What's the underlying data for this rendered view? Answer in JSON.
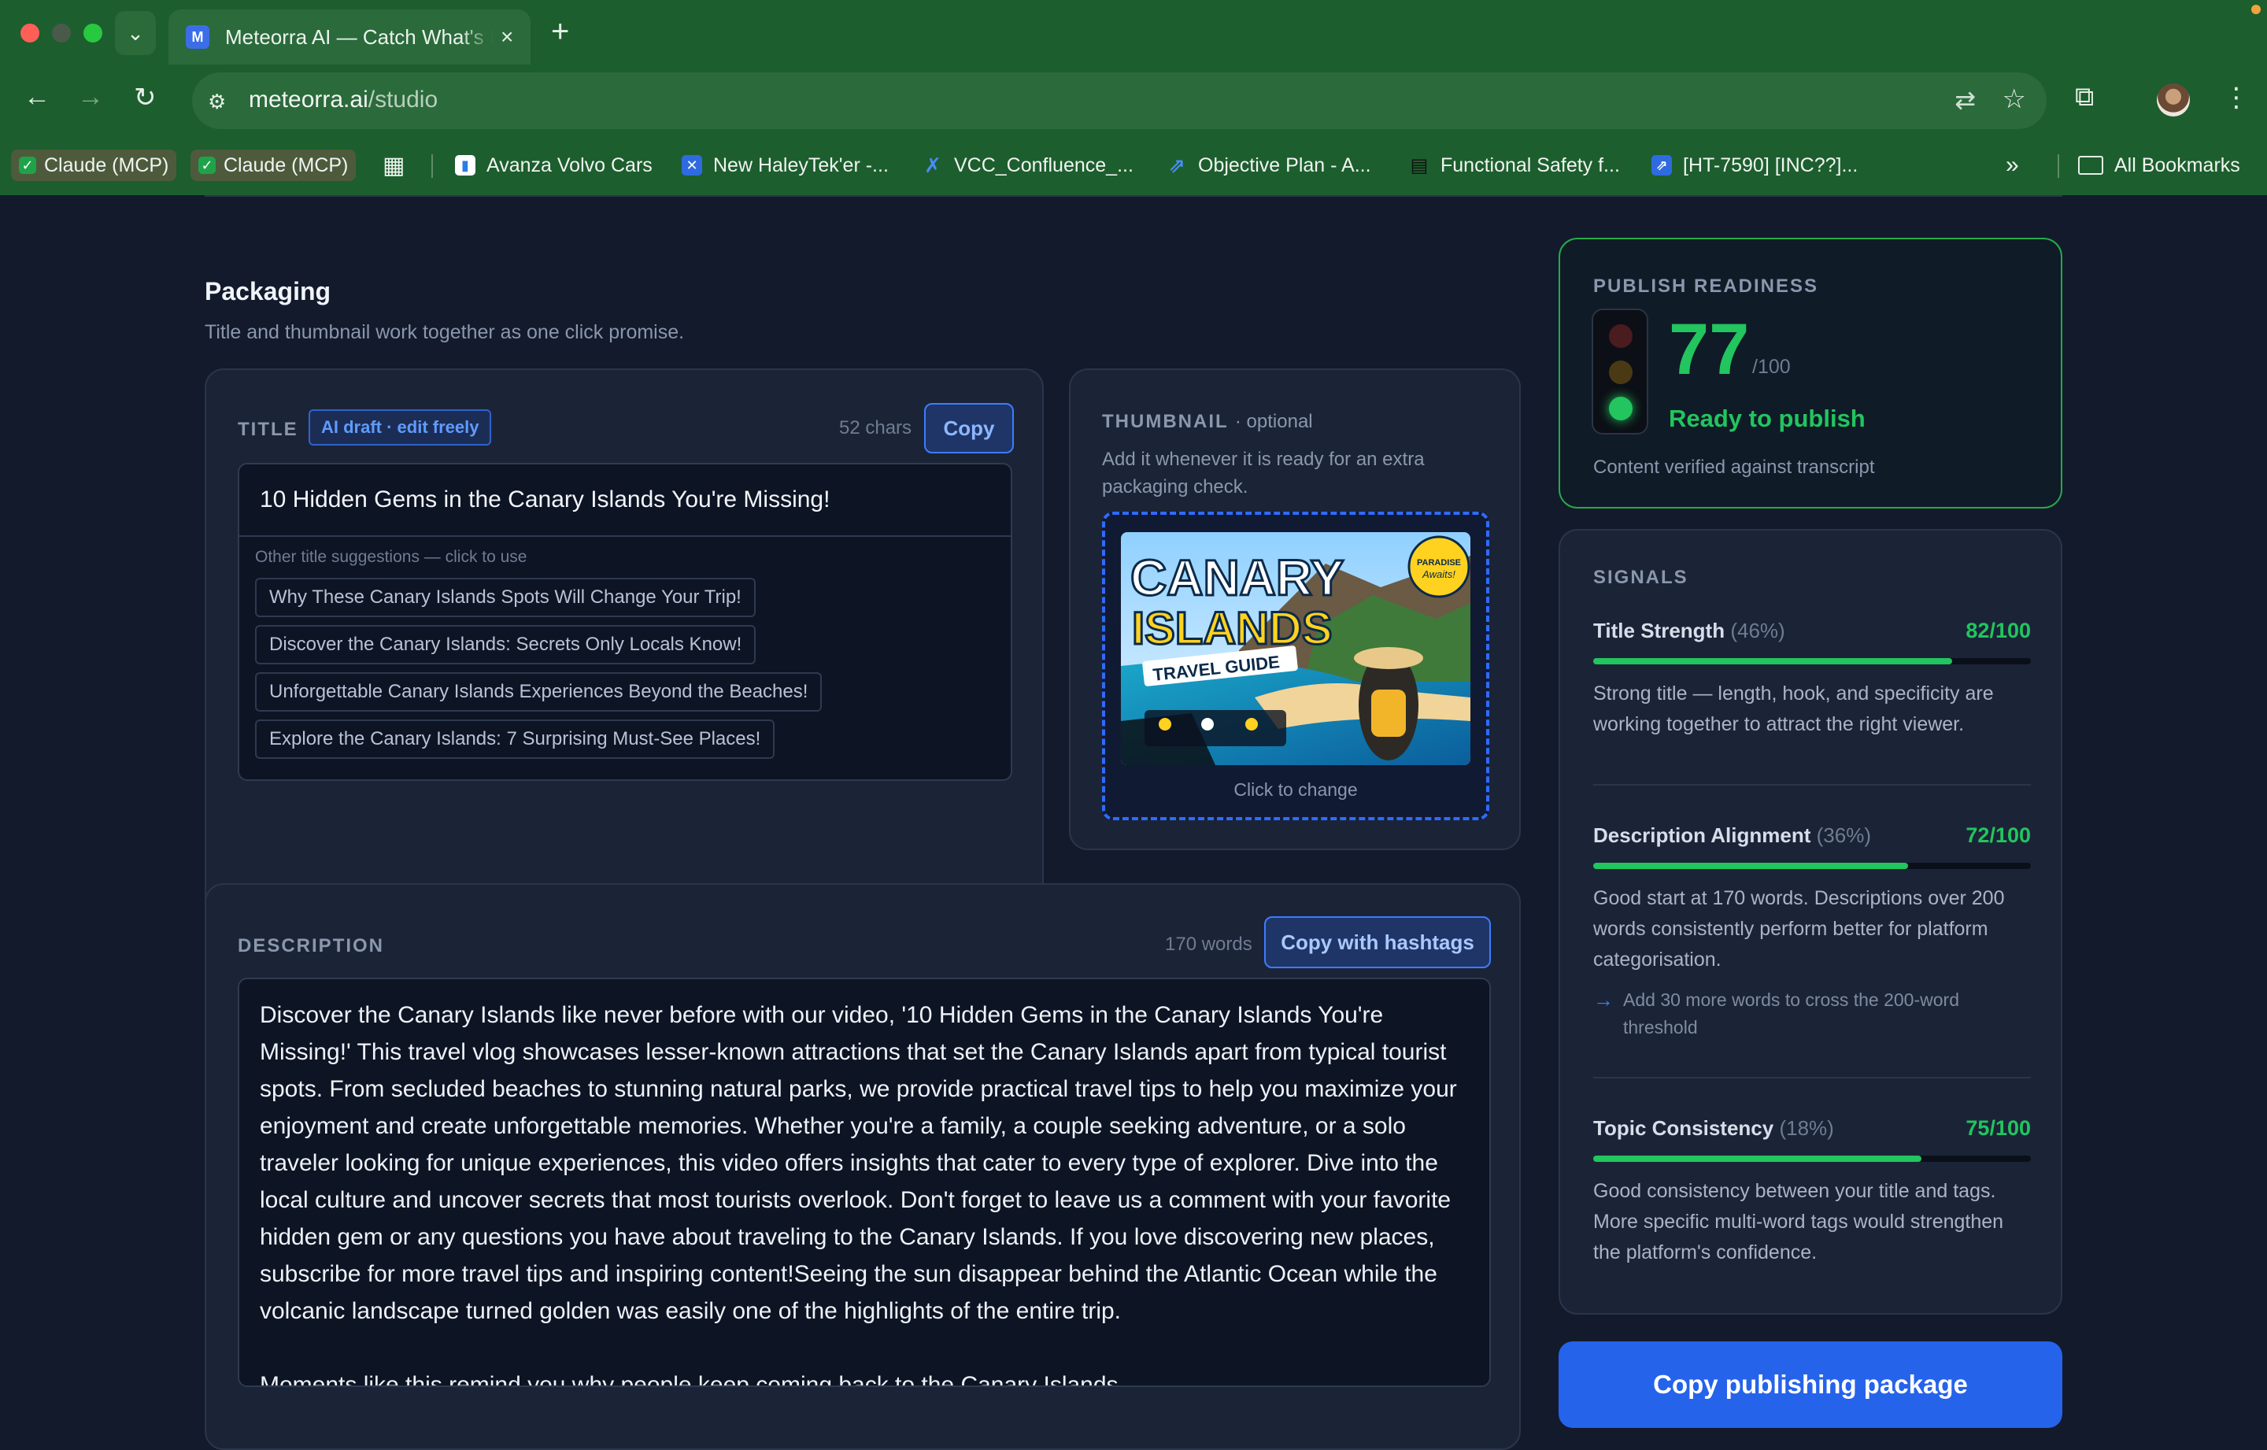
{
  "browser": {
    "tab_title": "Meteorra AI — Catch What's B",
    "tab_favicon": "M",
    "url_host": "meteorra.ai",
    "url_path": "/studio",
    "bookmarks": [
      {
        "label": "Claude (MCP)",
        "icon": "check-icon"
      },
      {
        "label": "Claude (MCP)",
        "icon": "check-icon"
      },
      {
        "label": "Avanza Volvo Cars",
        "icon": "chart-icon"
      },
      {
        "label": "New HaleyTek'er -...",
        "icon": "confluence-icon"
      },
      {
        "label": "VCC_Confluence_...",
        "icon": "confluence-icon"
      },
      {
        "label": "Objective Plan - A...",
        "icon": "jira-icon"
      },
      {
        "label": "Functional Safety f...",
        "icon": "document-icon"
      },
      {
        "label": "[HT-7590] [INC??]...",
        "icon": "jira-icon"
      }
    ],
    "all_bookmarks": "All Bookmarks"
  },
  "packaging": {
    "heading": "Packaging",
    "subtitle": "Title and thumbnail work together as one click promise."
  },
  "title_section": {
    "label": "TITLE",
    "badge": "AI draft · edit freely",
    "char_count": "52 chars",
    "copy_label": "Copy",
    "value": "10 Hidden Gems in the Canary Islands You're Missing!",
    "suggestions_label": "Other title suggestions — click to use",
    "suggestions": [
      "Why These Canary Islands Spots Will Change Your Trip!",
      "Discover the Canary Islands: Secrets Only Locals Know!",
      "Unforgettable Canary Islands Experiences Beyond the Beaches!",
      "Explore the Canary Islands: 7 Surprising Must-See Places!"
    ]
  },
  "thumbnail": {
    "label": "THUMBNAIL",
    "optional": "· optional",
    "help": "Add it whenever it is ready for an extra packaging check.",
    "image_text_1": "CANARY",
    "image_text_2": "ISLANDS",
    "image_text_3": "TRAVEL GUIDE",
    "image_badge_1": "PARADISE",
    "image_badge_2": "Awaits!",
    "change_label": "Click to change"
  },
  "description": {
    "label": "DESCRIPTION",
    "word_count": "170 words",
    "copy_label": "Copy with hashtags",
    "text": "Discover the Canary Islands like never before with our video, '10 Hidden Gems in the Canary Islands You're Missing!' This travel vlog showcases lesser-known attractions that set the Canary Islands apart from typical tourist spots. From secluded beaches to stunning natural parks, we provide practical travel tips to help you maximize your enjoyment and create unforgettable memories. Whether you're a family, a couple seeking adventure, or a solo traveler looking for unique experiences, this video offers insights that cater to every type of explorer. Dive into the local culture and uncover secrets that most tourists overlook. Don't forget to leave us a comment with your favorite hidden gem or any questions you have about traveling to the Canary Islands. If you love discovering new places, subscribe for more travel tips and inspiring content!Seeing the sun disappear behind the Atlantic Ocean while the volcanic landscape turned golden was easily one of the highlights of the entire trip.\n\nMoments like this remind you why people keep coming back to the Canary Islands."
  },
  "readiness": {
    "label": "PUBLISH READINESS",
    "score": "77",
    "max": "/100",
    "score_value": 77,
    "status": "Ready to publish",
    "verified": "Content verified against transcript",
    "light": "green"
  },
  "signals": {
    "label": "SIGNALS",
    "items": [
      {
        "name": "Title Strength",
        "weight": "(46%)",
        "score": "82/100",
        "value": 82,
        "desc": "Strong title — length, hook, and specificity are working together to attract the right viewer.",
        "tip": ""
      },
      {
        "name": "Description Alignment",
        "weight": "(36%)",
        "score": "72/100",
        "value": 72,
        "desc": "Good start at 170 words. Descriptions over 200 words consistently perform better for platform categorisation.",
        "tip": "Add 30 more words to cross the 200-word threshold"
      },
      {
        "name": "Topic Consistency",
        "weight": "(18%)",
        "score": "75/100",
        "value": 75,
        "desc": "Good consistency between your title and tags. More specific multi-word tags would strengthen the platform's confidence.",
        "tip": ""
      }
    ]
  },
  "copy_package_label": "Copy publishing package",
  "colors": {
    "accent": "#2563eb",
    "success": "#22c55e",
    "background": "#121a2b",
    "card": "#1b2437"
  }
}
